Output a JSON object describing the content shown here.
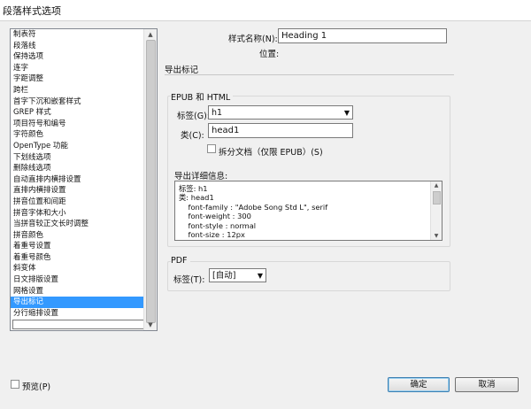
{
  "window": {
    "title": "段落样式选项"
  },
  "sidebar": {
    "items": [
      {
        "label": "制表符"
      },
      {
        "label": "段落线"
      },
      {
        "label": "保持选项"
      },
      {
        "label": "连字"
      },
      {
        "label": "字距调整"
      },
      {
        "label": "跨栏"
      },
      {
        "label": "首字下沉和嵌套样式"
      },
      {
        "label": "GREP 样式"
      },
      {
        "label": "项目符号和编号"
      },
      {
        "label": "字符颜色"
      },
      {
        "label": "OpenType 功能"
      },
      {
        "label": "下划线选项"
      },
      {
        "label": "删除线选项"
      },
      {
        "label": "自动直排内横排设置"
      },
      {
        "label": "直排内横排设置"
      },
      {
        "label": "拼音位置和间距"
      },
      {
        "label": "拼音字体和大小"
      },
      {
        "label": "当拼音较正文长时调整"
      },
      {
        "label": "拼音颜色"
      },
      {
        "label": "着重号设置"
      },
      {
        "label": "着重号颜色"
      },
      {
        "label": "斜变体"
      },
      {
        "label": "日文排版设置"
      },
      {
        "label": "网格设置"
      },
      {
        "label": "导出标记"
      },
      {
        "label": "分行缩排设置"
      }
    ],
    "selected_index": 24
  },
  "style_name": {
    "label": "样式名称(N):",
    "value": "Heading 1"
  },
  "location": {
    "label": "位置:"
  },
  "section_title": "导出标记",
  "epub": {
    "group_label": "EPUB 和 HTML",
    "tag_label": "标签(G):",
    "tag_value": "h1",
    "class_label": "类(C):",
    "class_value": "head1",
    "split_label": "拆分文档（仅限 EPUB）(S)",
    "split_checked": false,
    "details_label": "导出详细信息:",
    "details_lines": [
      "标签: h1",
      "类: head1",
      "    font-family : \"Adobe Song Std L\", serif",
      "    font-weight : 300",
      "    font-style : normal",
      "    font-size : 12px"
    ]
  },
  "pdf": {
    "group_label": "PDF",
    "tag_label": "标签(T):",
    "tag_value": "[自动]"
  },
  "footer": {
    "preview_label": "预览(P)",
    "preview_checked": false,
    "ok_label": "确定",
    "cancel_label": "取消"
  },
  "icons": {
    "dropdown": "chevron-down-icon",
    "scroll_up": "arrow-up-icon",
    "scroll_down": "arrow-down-icon"
  }
}
